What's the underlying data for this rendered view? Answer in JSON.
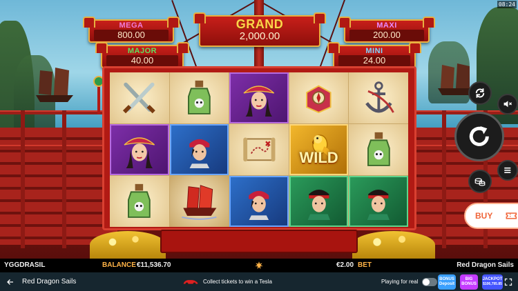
{
  "clock": "08:24",
  "jackpots": {
    "mega": {
      "title": "MEGA",
      "value": "800.00",
      "title_color": "#f07ad8"
    },
    "grand": {
      "title": "GRAND",
      "value": "2,000.00",
      "title_color": "#ffd34a"
    },
    "maxi": {
      "title": "MAXI",
      "value": "200.00",
      "title_color": "#e98aff"
    },
    "major": {
      "title": "MAJOR",
      "value": "40.00",
      "title_color": "#5fe05f"
    },
    "mini": {
      "title": "MINI",
      "value": "24.00",
      "title_color": "#7fd6ff"
    }
  },
  "reels": {
    "wild_label": "WILD",
    "rows": [
      [
        "crossed-swords-icon",
        "pirate-woman-icon",
        "compass-box-icon",
        "anchor-icon"
      ],
      [
        "pirate-woman-icon",
        "pirate-man-blue-icon",
        "treasure-map-icon",
        "golden-parrot-wild-icon",
        "skull-bottle-icon"
      ],
      [
        "skull-bottle-icon",
        "red-junk-ship-icon",
        "pirate-man-blue-icon",
        "pirate-man-green-icon",
        "pirate-man-green-icon"
      ]
    ]
  },
  "controls": {
    "buy_label": "BUY",
    "icons": [
      "autoplay-icon",
      "sound-off-icon",
      "spin-icon",
      "menu-icon",
      "coin-stack-icon",
      "ticket-icon"
    ]
  },
  "status_bar": {
    "provider": "YGGDRASIL",
    "balance_label": "BALANCE",
    "balance_value": "€11,536.70",
    "bet_value": "€2.00",
    "bet_label": "BET",
    "game_name": "Red Dragon Sails"
  },
  "casino_bar": {
    "title": "Red Dragon Sails",
    "promo_text": "Collect tickets to win a Tesla",
    "playing_label": "Playing for real",
    "promo_badges": [
      {
        "label": "BONUS",
        "sub": "Deposit",
        "color": "#3aa0ff"
      },
      {
        "label": "BIG",
        "sub": "BONUS",
        "color": "#c43cff"
      },
      {
        "label": "JACKPOT",
        "sub": "$106,795.85",
        "color": "#4455ff"
      }
    ]
  },
  "colors": {
    "ship_red": "#b11a14",
    "trim_gold": "#e8b040",
    "status_amber": "#ffb347",
    "buy_orange": "#f06438"
  }
}
